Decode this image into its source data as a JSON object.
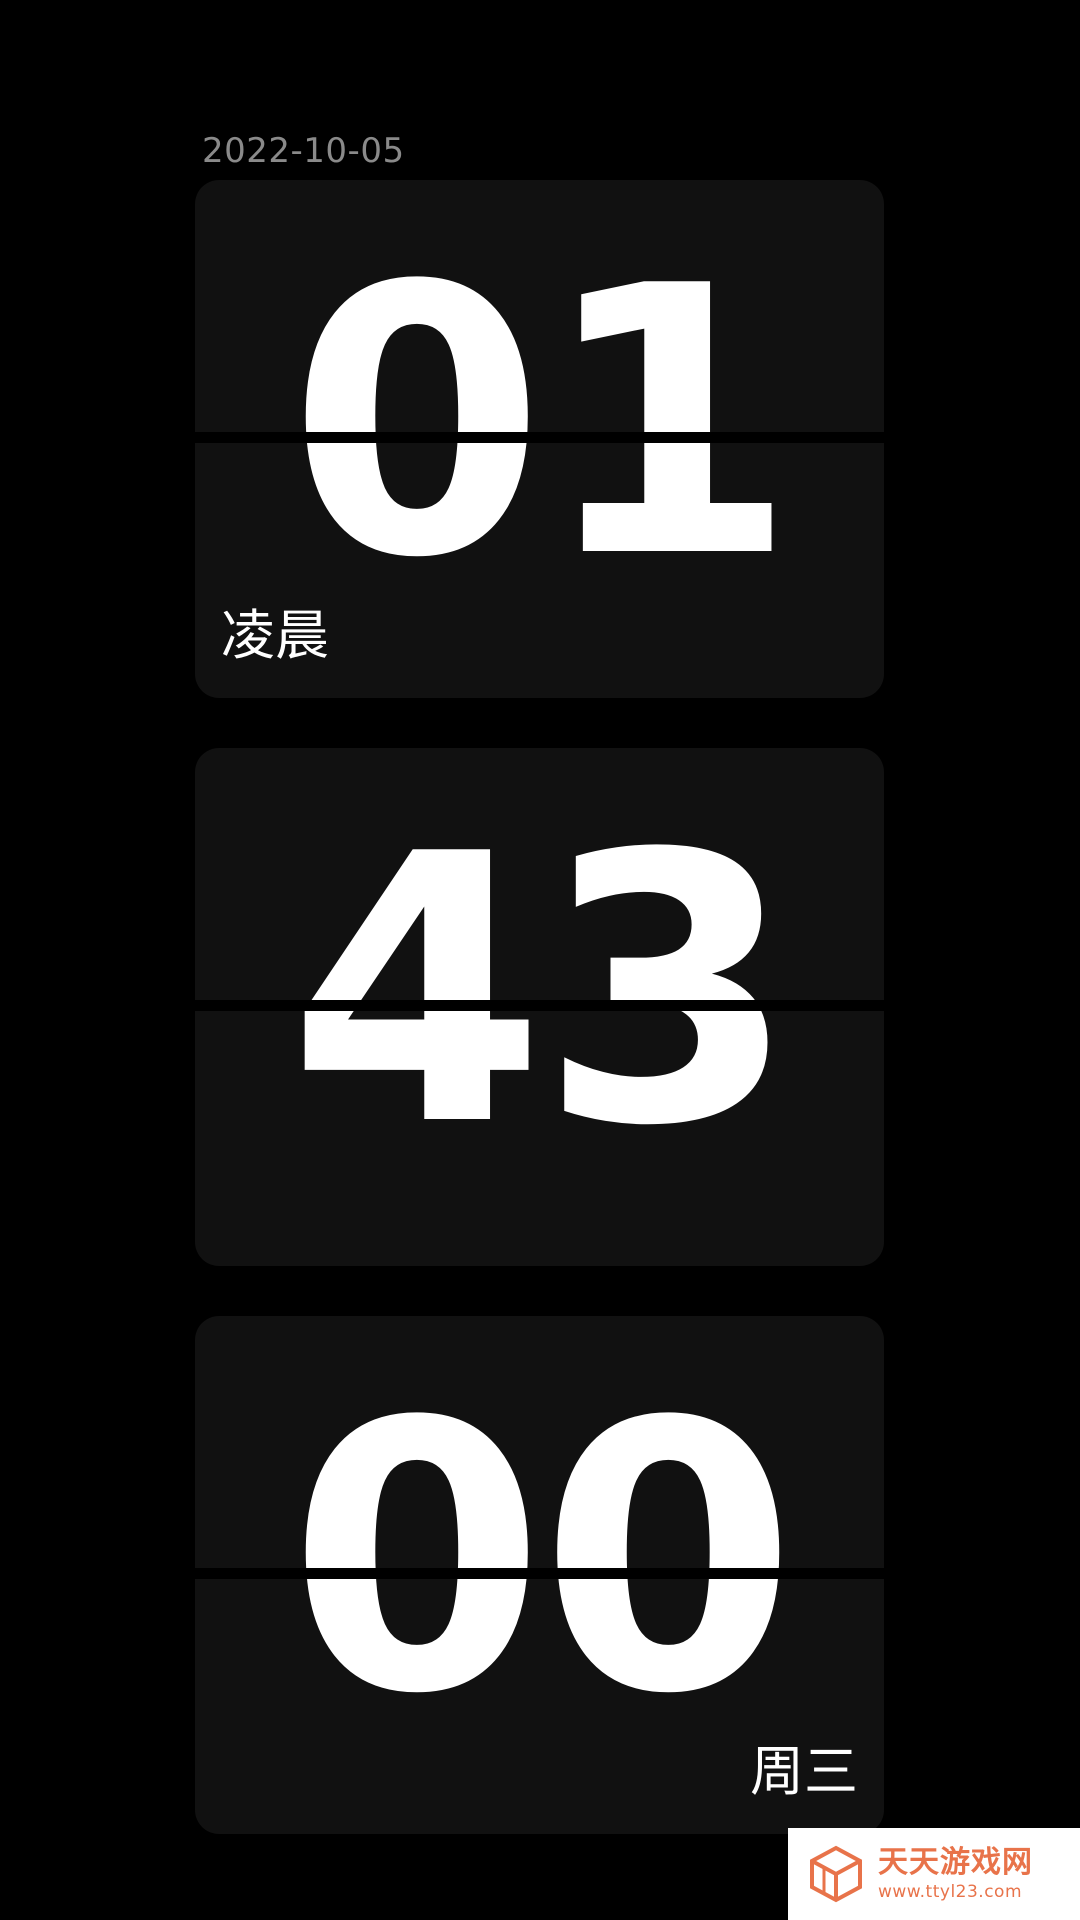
{
  "date": "2022-10-05",
  "hour": {
    "digits": "01",
    "label": "凌晨"
  },
  "minute": {
    "digits": "43"
  },
  "second": {
    "digits": "00",
    "label": "周三"
  },
  "watermark": {
    "title": "天天游戏网",
    "url": "www.ttyl23.com",
    "logo_icon": "cube-logo-icon",
    "color": "#e8734a"
  },
  "colors": {
    "background": "#000000",
    "card": "#111111",
    "digit": "#ffffff",
    "date_text": "#8a8a8a"
  }
}
